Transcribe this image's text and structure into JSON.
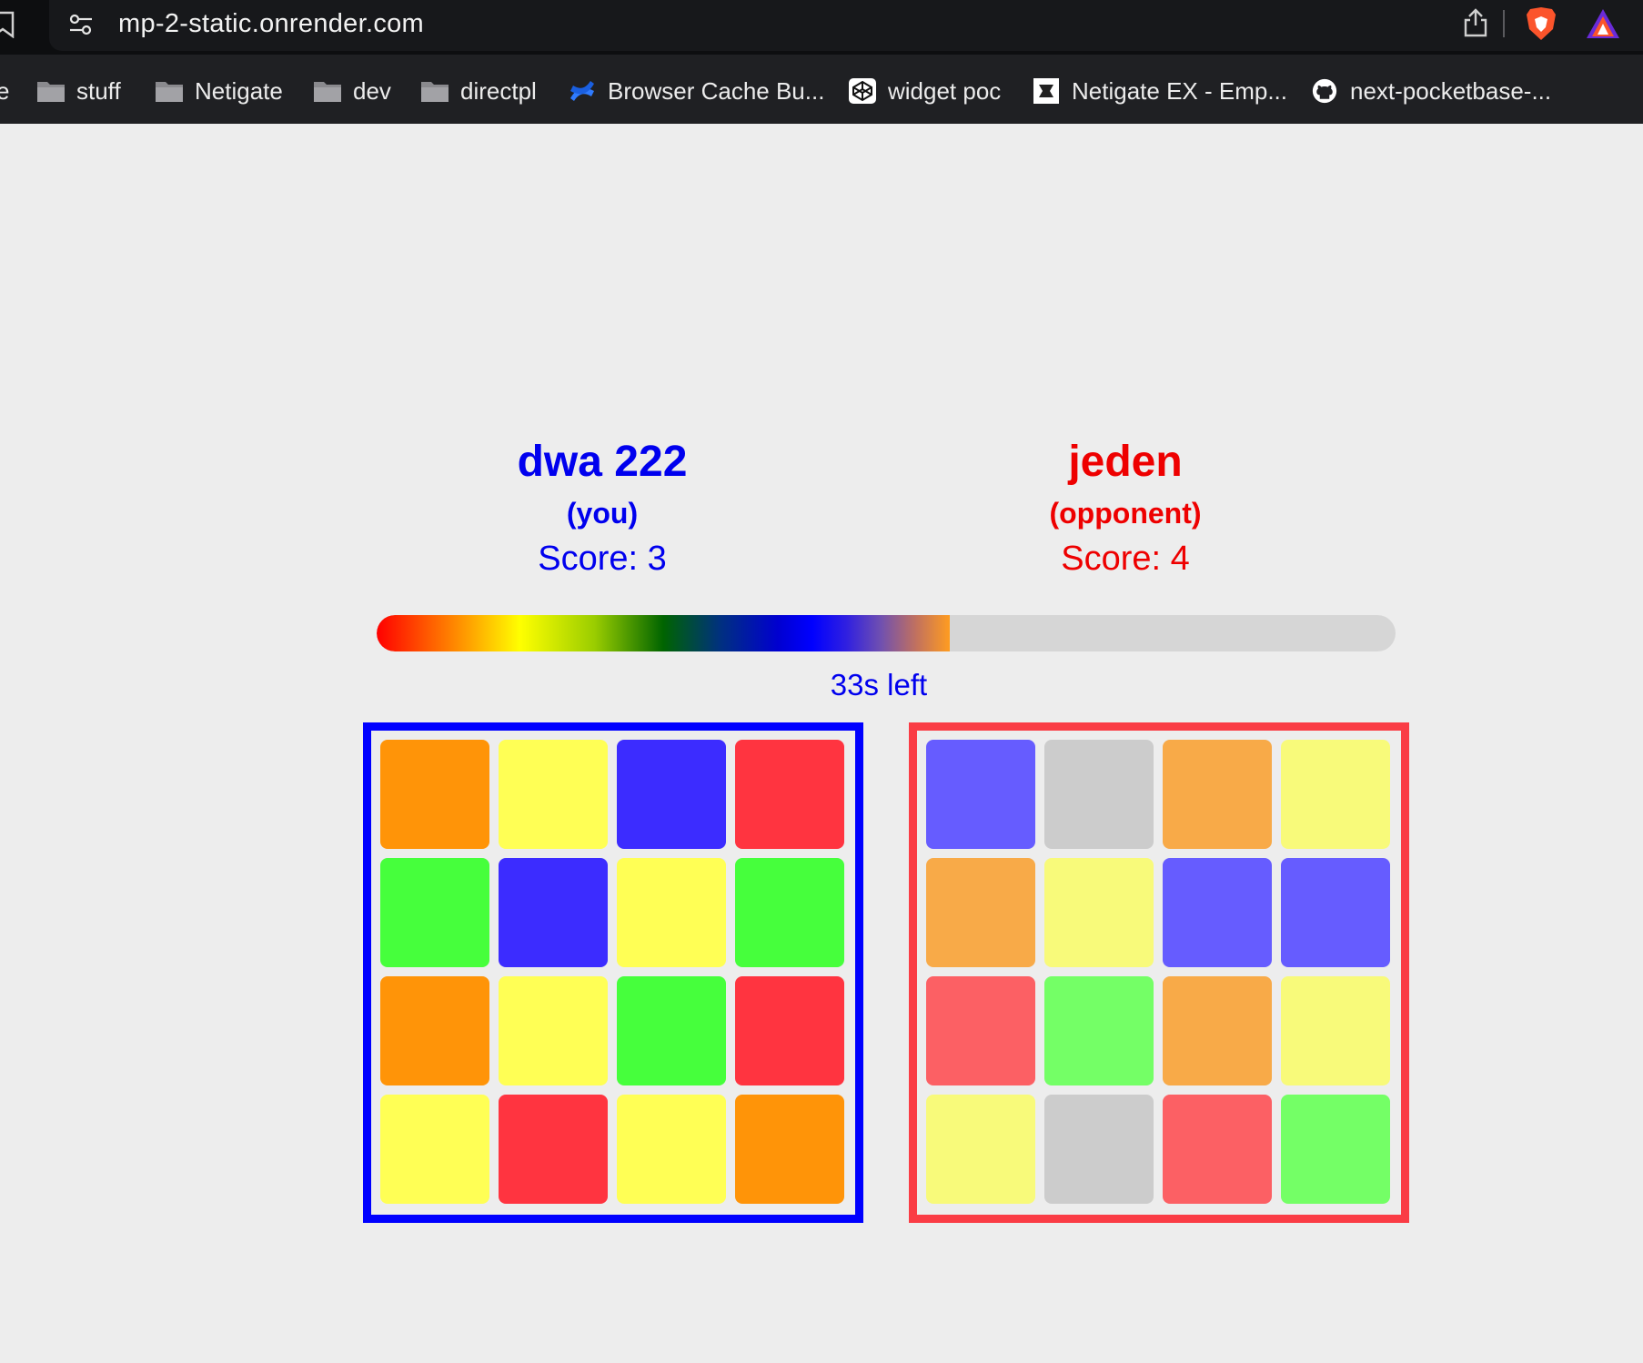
{
  "browser": {
    "url": "mp-2-static.onrender.com",
    "bookmarks": [
      {
        "label": "e",
        "icon": "none"
      },
      {
        "label": "stuff",
        "icon": "folder-icon"
      },
      {
        "label": "Netigate",
        "icon": "folder-icon"
      },
      {
        "label": "dev",
        "icon": "folder-icon"
      },
      {
        "label": "directpl",
        "icon": "folder-icon"
      },
      {
        "label": "Browser Cache Bu...",
        "icon": "confluence-icon"
      },
      {
        "label": "widget poc",
        "icon": "codepen-icon"
      },
      {
        "label": "Netigate EX - Emp...",
        "icon": "netigate-icon"
      },
      {
        "label": "next-pocketbase-...",
        "icon": "github-icon"
      }
    ]
  },
  "game": {
    "you": {
      "name": "dwa 222",
      "role": "(you)",
      "score": "Score: 3",
      "color": "#0000ee"
    },
    "opponent": {
      "name": "jeden",
      "role": "(opponent)",
      "score": "Score: 4",
      "color": "#ee0000"
    },
    "timer": {
      "label": "33s left",
      "progress": 0.5625
    }
  },
  "boards": {
    "you": {
      "border_color": "#0000ff",
      "tiles": [
        "#ff9408",
        "#ffff55",
        "#3c2cff",
        "#ff3440",
        "#46ff3c",
        "#3c2cff",
        "#ffff55",
        "#46ff3c",
        "#ff9408",
        "#ffff55",
        "#46ff3c",
        "#ff3440",
        "#ffff55",
        "#ff3440",
        "#ffff55",
        "#ff9408"
      ]
    },
    "opponent": {
      "border_color": "#fa3c45",
      "tiles": [
        "#665cff",
        "#cccccc",
        "#f8aa48",
        "#f8fa7a",
        "#f8aa48",
        "#f8fa7a",
        "#665cff",
        "#665cff",
        "#fc6064",
        "#74ff66",
        "#f8aa48",
        "#f8fa7a",
        "#f8fa7a",
        "#cccccc",
        "#fc6064",
        "#74ff66"
      ]
    }
  }
}
